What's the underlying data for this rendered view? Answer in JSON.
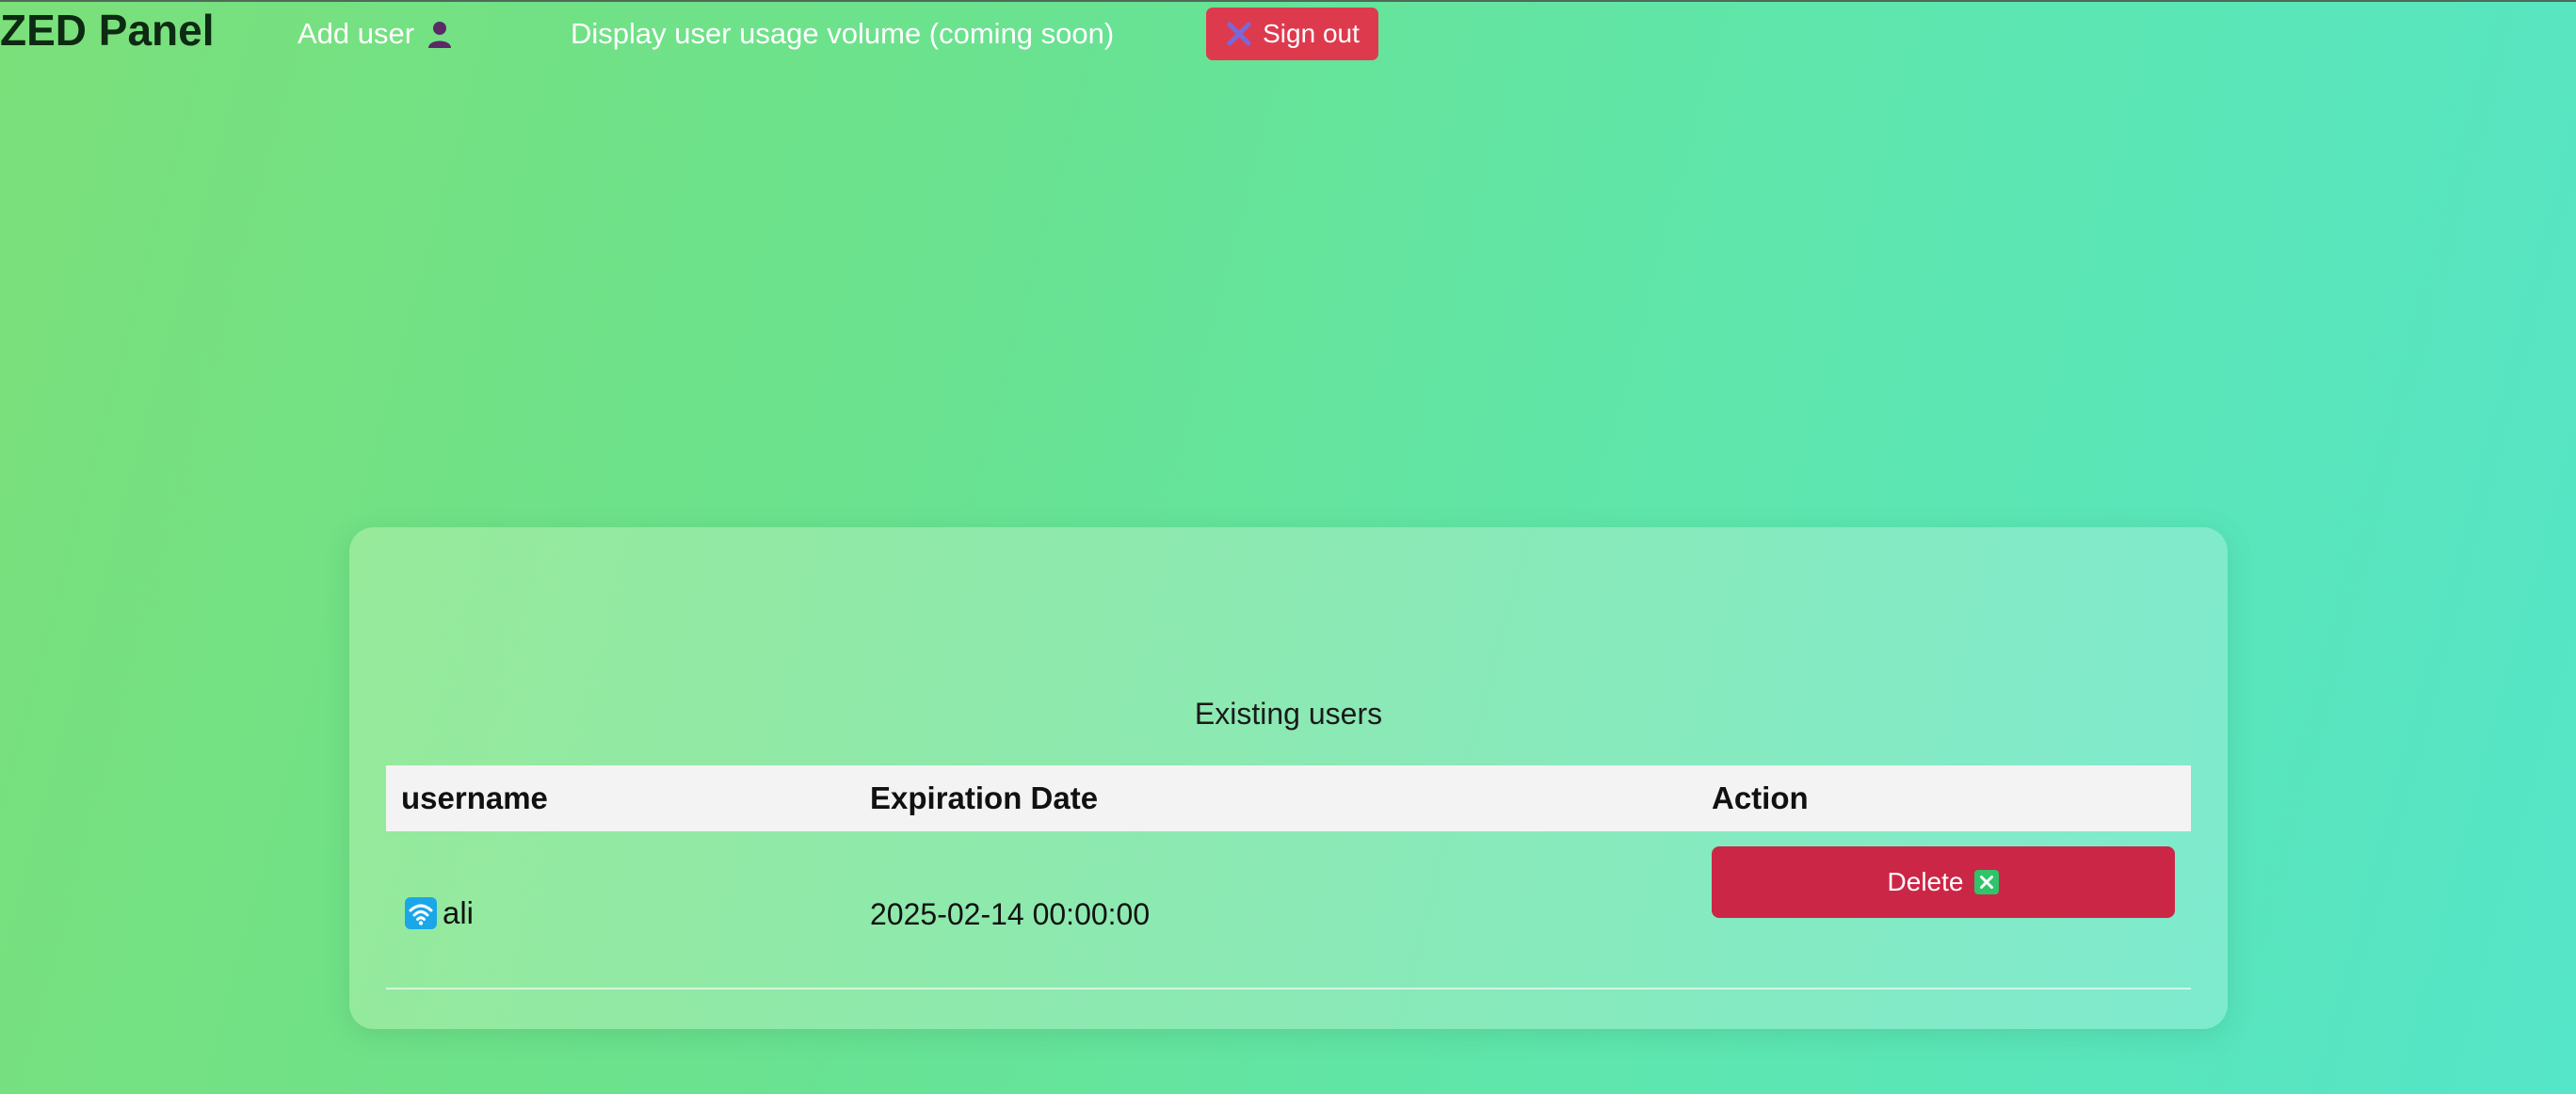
{
  "header": {
    "brand": "ZED Panel",
    "add_user_label": "Add user",
    "add_user_icon": "user-silhouette-icon",
    "usage_label": "Display user usage volume (coming soon)",
    "signout_label": "Sign out",
    "signout_icon": "cross-x-icon"
  },
  "users_section": {
    "title": "Existing users",
    "columns": [
      "username",
      "Expiration Date",
      "Action"
    ],
    "rows": [
      {
        "username": "ali",
        "status_icon": "wifi-icon",
        "expiration": "2025-02-14 00:00:00",
        "action_label": "Delete",
        "action_icon": "cross-mark-button-icon"
      }
    ]
  },
  "colors": {
    "signout_button": "#de3a4d",
    "delete_button": "#cc2647",
    "table_header_bg": "#f3f3f3",
    "gradient_start": "#7be07a",
    "gradient_end": "#55e5c8"
  }
}
